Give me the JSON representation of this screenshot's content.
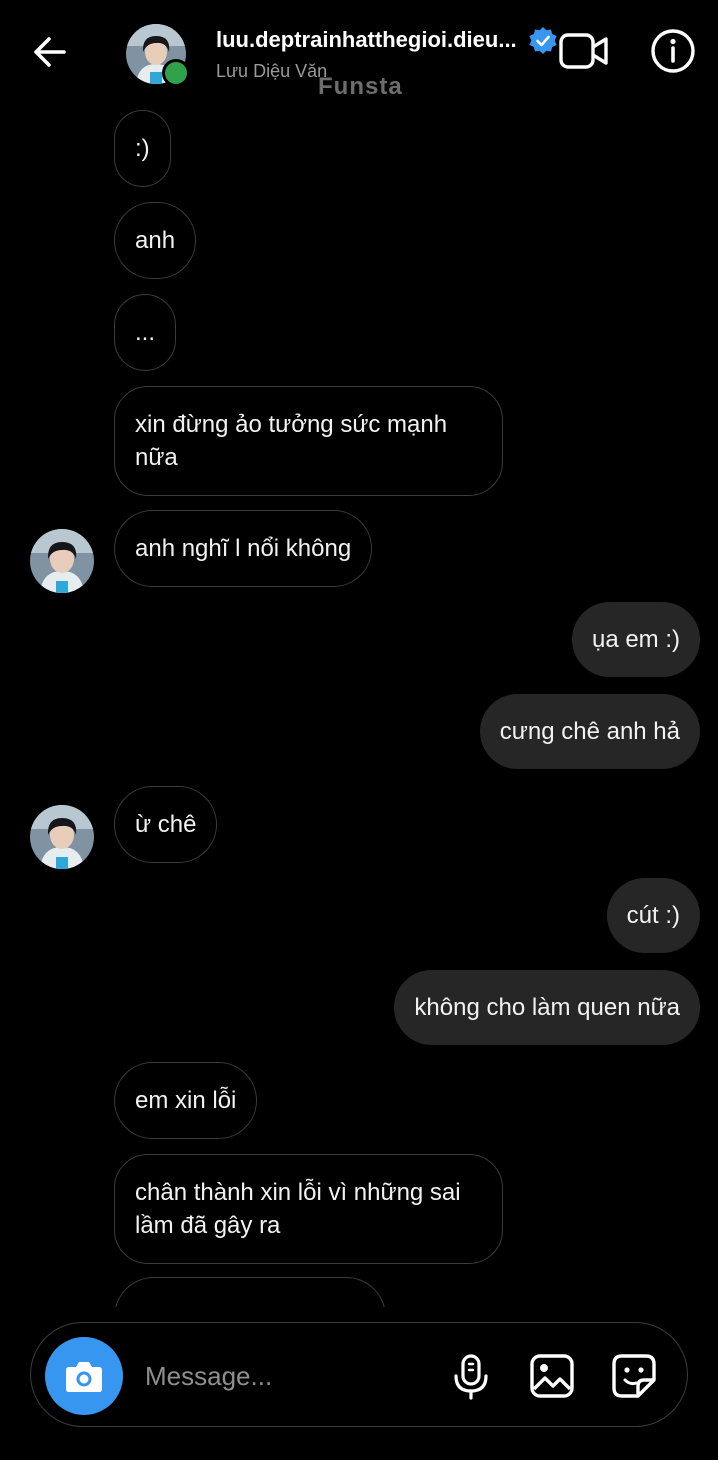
{
  "header": {
    "username": "luu.deptrainhatthegioi.dieu...",
    "display_name": "Lưu Diệu Văn",
    "watermark": "Funsta"
  },
  "messages": [
    {
      "from": "them",
      "text": ":)"
    },
    {
      "from": "them",
      "text": "anh"
    },
    {
      "from": "them",
      "text": "..."
    },
    {
      "from": "them",
      "text": "xin đừng ảo tưởng sức mạnh nữa"
    },
    {
      "from": "them",
      "text": "anh nghĩ  l  nổi không"
    },
    {
      "from": "me",
      "text": "ụa em :)"
    },
    {
      "from": "me",
      "text": "cưng chê anh hả"
    },
    {
      "from": "them",
      "text": "ừ chê"
    },
    {
      "from": "me",
      "text": "cút :)"
    },
    {
      "from": "me",
      "text": "không cho làm quen nữa"
    },
    {
      "from": "them",
      "text": "em xin lỗi"
    },
    {
      "from": "them",
      "text": "chân thành xin lỗi vì những sai lầm đã gây ra"
    }
  ],
  "composer": {
    "placeholder": "Message..."
  },
  "colors": {
    "accent": "#3797f0",
    "online": "#31a24c",
    "outgoing_bubble": "#262626",
    "incoming_border": "#3b3b3b"
  },
  "icons": [
    "back-arrow-icon",
    "verified-badge-icon",
    "video-camera-icon",
    "info-icon",
    "camera-icon",
    "microphone-icon",
    "gallery-icon",
    "sticker-icon"
  ]
}
